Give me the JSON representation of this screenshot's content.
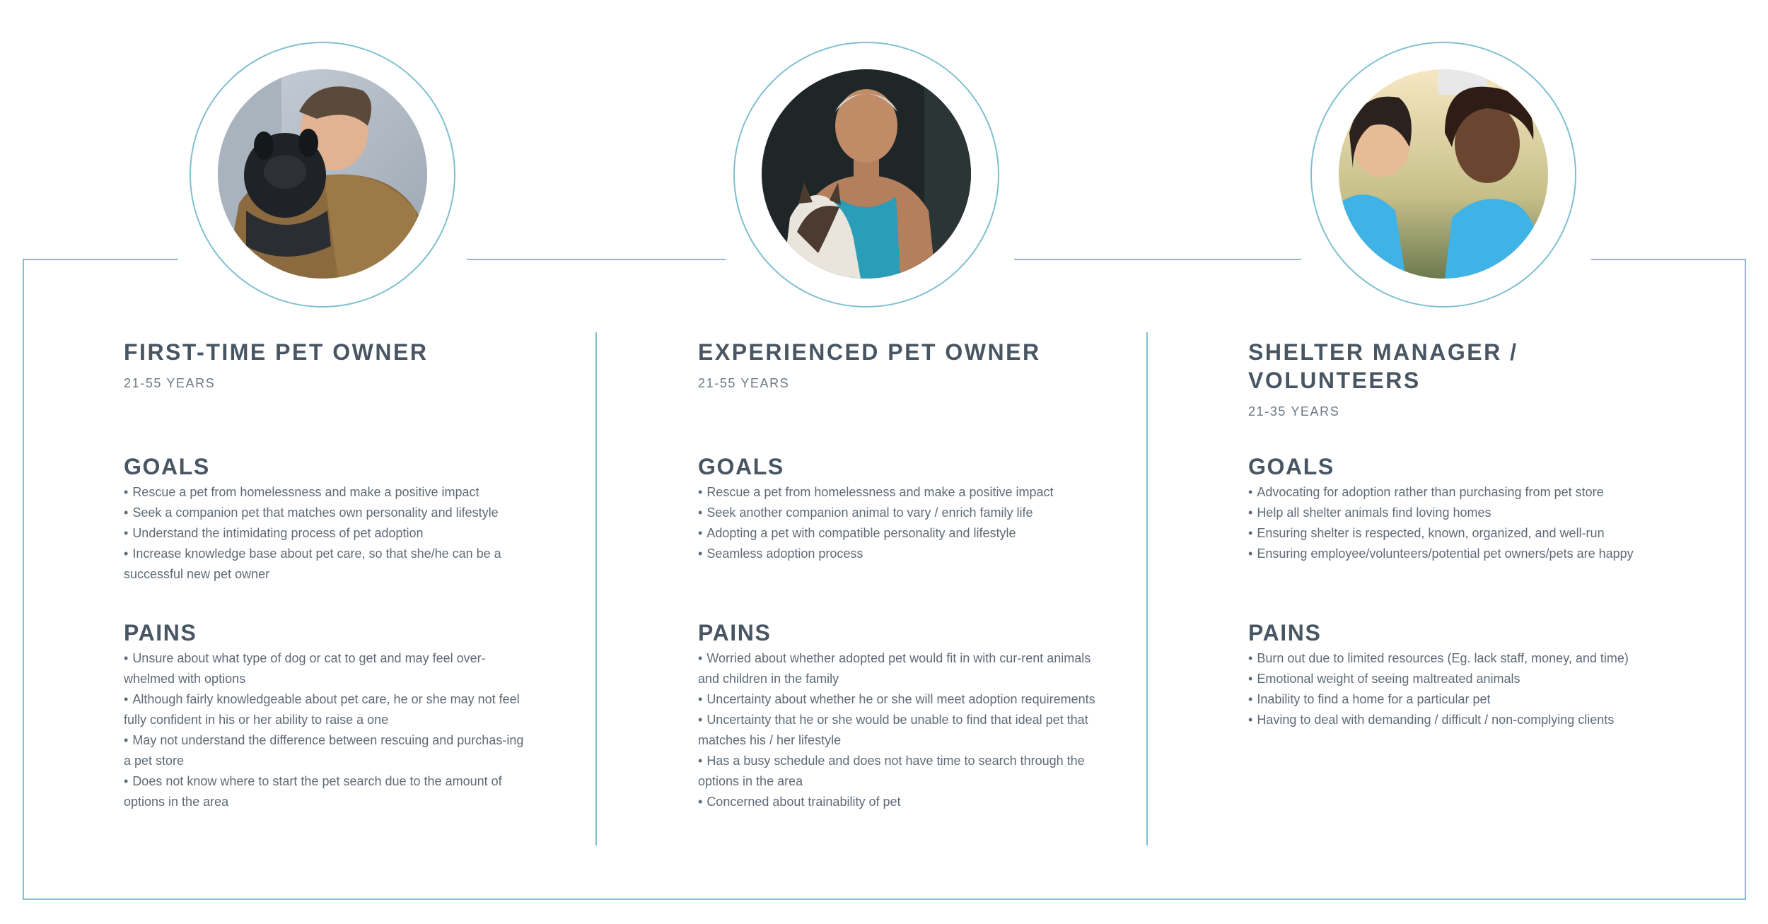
{
  "personas": [
    {
      "title": "FIRST-TIME PET OWNER",
      "age": "21-55 YEARS",
      "photo_icon": "person-with-dog-photo",
      "goals_heading": "GOALS",
      "goals": [
        "Rescue a pet from homelessness and make a positive impact",
        "Seek a companion pet that matches own personality and lifestyle",
        "Understand the intimidating process of pet adoption",
        "Increase knowledge base about pet care, so that she/he can be a successful new pet owner"
      ],
      "pains_heading": "PAINS",
      "pains": [
        "Unsure about what type of dog or cat to get and may feel over-whelmed with options",
        "Although fairly knowledgeable about pet care, he or she may not feel fully confident in his or her ability to raise a one",
        "May not understand the difference between rescuing and purchas-ing a pet store",
        "Does not know where to start the pet search due to the amount of options in the area"
      ]
    },
    {
      "title": "EXPERIENCED PET OWNER",
      "age": "21-55 YEARS",
      "photo_icon": "man-with-husky-photo",
      "goals_heading": "GOALS",
      "goals": [
        "Rescue a pet from homelessness and make a positive impact",
        "Seek another companion animal to vary / enrich family life",
        "Adopting a pet with compatible personality and lifestyle",
        "Seamless adoption process"
      ],
      "pains_heading": "PAINS",
      "pains": [
        "Worried about whether adopted pet would fit in with cur-rent animals and children in the family",
        "Uncertainty about whether he or she will meet adoption requirements",
        "Uncertainty that he or she would be unable to find that ideal pet that matches his / her lifestyle",
        "Has a busy schedule and does not have time to search through the options in the area",
        "Concerned about trainability of pet"
      ]
    },
    {
      "title": "SHELTER MANAGER / VOLUNTEERS",
      "age": "21-35 YEARS",
      "photo_icon": "two-volunteers-selfie-photo",
      "goals_heading": "GOALS",
      "goals": [
        "Advocating for adoption rather than purchasing from pet store",
        "Help all shelter animals find loving homes",
        "Ensuring shelter is respected, known, organized, and well-run",
        "Ensuring employee/volunteers/potential pet owners/pets are happy"
      ],
      "pains_heading": "PAINS",
      "pains": [
        "Burn out due to limited resources (Eg. lack staff, money, and time)",
        "Emotional weight of seeing maltreated animals",
        "Inability to find a home for a particular pet",
        "Having to deal with demanding / difficult / non-complying clients"
      ]
    }
  ],
  "colors": {
    "accent_line": "#7fbfd2",
    "heading_text": "#485563",
    "body_text": "#5f6a76"
  }
}
